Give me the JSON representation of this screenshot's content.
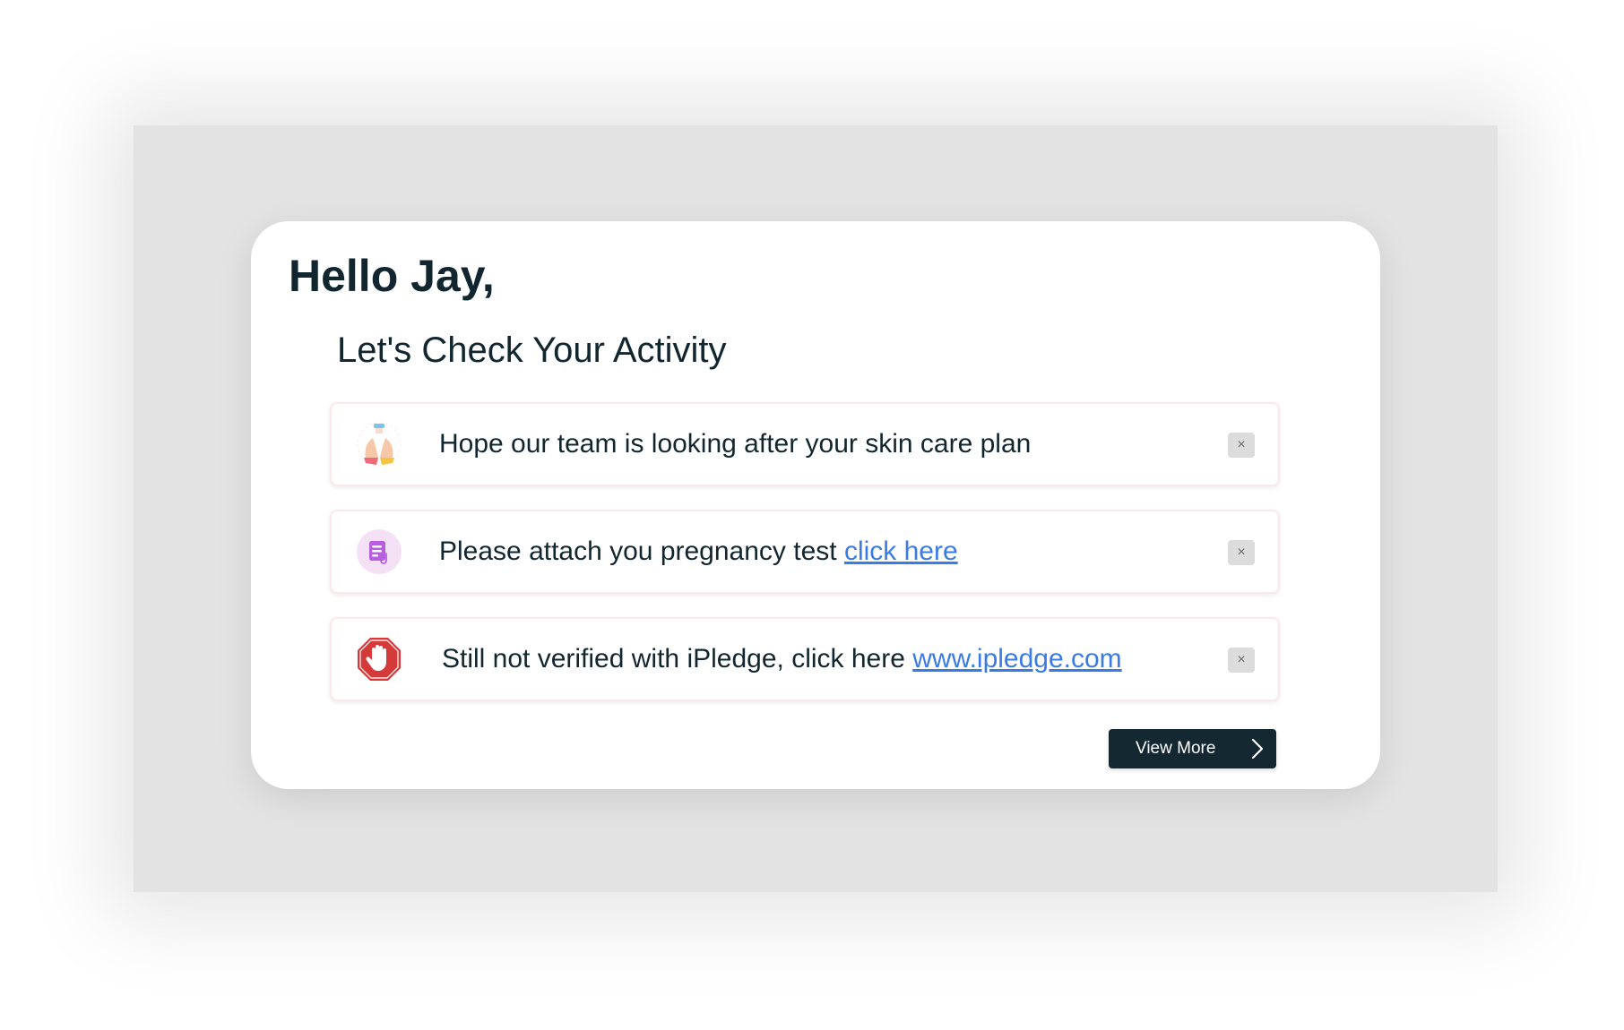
{
  "greeting": "Hello Jay,",
  "subtitle": "Let's Check Your Activity",
  "notifications": [
    {
      "icon": "hand-care-icon",
      "text": "Hope our team is looking after your skin care plan",
      "link_text": "",
      "close_label": "×"
    },
    {
      "icon": "document-attach-icon",
      "text": "Please attach you pregnancy test ",
      "link_text": "click here",
      "close_label": "×"
    },
    {
      "icon": "stop-hand-icon",
      "text": "Still not verified with iPledge, click here ",
      "link_text": "www.ipledge.com",
      "close_label": "×"
    }
  ],
  "view_more": {
    "label": "View More",
    "icon": "chevron-right-icon"
  },
  "colors": {
    "text_dark": "#122630",
    "link": "#3b7be6",
    "button_bg": "#142831",
    "backdrop": "#e3e3e3"
  }
}
